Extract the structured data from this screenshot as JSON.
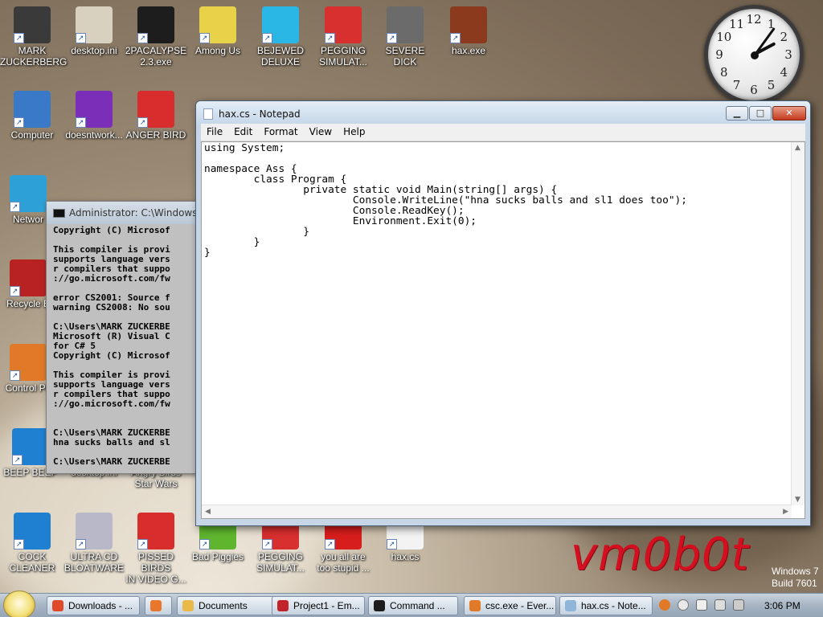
{
  "desktop": {
    "icons": [
      {
        "label": "MARK\nZUCKERBERG",
        "color": "#3a3a3a"
      },
      {
        "label": "desktop.ini",
        "color": "#d9d1c0"
      },
      {
        "label": "2PACALYPSE\n2.3.exe",
        "color": "#1d1d1d"
      },
      {
        "label": "Among Us",
        "color": "#e8d24a"
      },
      {
        "label": "BEJEWED\nDELUXE",
        "color": "#2bb7e6"
      },
      {
        "label": "PEGGING\nSIMULAT...",
        "color": "#d82f2f"
      },
      {
        "label": "SEVERE DICK",
        "color": "#6b6b6b"
      },
      {
        "label": "hax.exe",
        "color": "#8b3a1d"
      },
      {
        "label": "Computer",
        "color": "#3a79c8"
      },
      {
        "label": "doesntwork...",
        "color": "#7b2fb8"
      },
      {
        "label": "ANGER BIRD",
        "color": "#d82d2d"
      },
      {
        "label": "Networ",
        "color": "#2da0d8"
      },
      {
        "label": "Recycle B",
        "color": "#b82222"
      },
      {
        "label": "Control Pa",
        "color": "#e07a28"
      },
      {
        "label": "BEEP BEEP",
        "color": "#1f7fd0"
      },
      {
        "label": "desktop.ini",
        "color": "#d9d1c0"
      },
      {
        "label": "Angry Birds\nStar Wars",
        "color": "#c23b2b"
      },
      {
        "label": "COCK\nCLEANER",
        "color": "#1f7fd0"
      },
      {
        "label": "ULTRA CD\nBLOATWARE",
        "color": "#b8b8c8"
      },
      {
        "label": "PISSED BIRDS\nIN VIDEO G...",
        "color": "#d82d2d"
      },
      {
        "label": "Bad Piggies",
        "color": "#5fb52e"
      },
      {
        "label": "PEGGING\nSIMULAT...",
        "color": "#d82f2f"
      },
      {
        "label": "you all are\ntoo stupid ...",
        "color": "#d81d1d"
      },
      {
        "label": "hax.cs",
        "color": "#f3f3f3"
      }
    ],
    "clock_numbers": [
      "12",
      "1",
      "2",
      "3",
      "4",
      "5",
      "6",
      "7",
      "8",
      "9",
      "10",
      "11"
    ],
    "watermark": "vm0b0t",
    "os_version": [
      "Windows 7",
      "Build 7601"
    ]
  },
  "cmd_window": {
    "title": "Administrator: C:\\Windows\\sy",
    "text": "Copyright (C) Microsof\n\nThis compiler is provi\nsupports language vers\nr compilers that suppo\n://go.microsoft.com/fw\n\nerror CS2001: Source f\nwarning CS2008: No sou\n\nC:\\Users\\MARK ZUCKERBE\nMicrosoft (R) Visual C\nfor C# 5\nCopyright (C) Microsof\n\nThis compiler is provi\nsupports language vers\nr compilers that suppo\n://go.microsoft.com/fw\n\n\nC:\\Users\\MARK ZUCKERBE\nhna sucks balls and sl\n\nC:\\Users\\MARK ZUCKERBE"
  },
  "notepad": {
    "title": "hax.cs - Notepad",
    "menu": [
      "File",
      "Edit",
      "Format",
      "View",
      "Help"
    ],
    "content": "using System;\n\nnamespace Ass {\n        class Program {\n                private static void Main(string[] args) {\n                        Console.WriteLine(\"hna sucks balls and sl1 does too\");\n                        Console.ReadKey();\n                        Environment.Exit(0);\n                }\n        }\n}"
  },
  "taskbar": {
    "items": [
      {
        "label": "Downloads - ...",
        "color": "#e04a2a"
      },
      {
        "label": "",
        "color": "#e8762b"
      },
      {
        "label": "Documents",
        "color": "#e9b94a"
      },
      {
        "label": "Project1 - Em...",
        "color": "#c2242b"
      },
      {
        "label": "Command ...",
        "color": "#1d1d1d"
      },
      {
        "label": "csc.exe - Ever...",
        "color": "#e07a28"
      },
      {
        "label": "hax.cs - Note...",
        "color": "#8fb5d9"
      }
    ],
    "time": "3:06 PM"
  }
}
